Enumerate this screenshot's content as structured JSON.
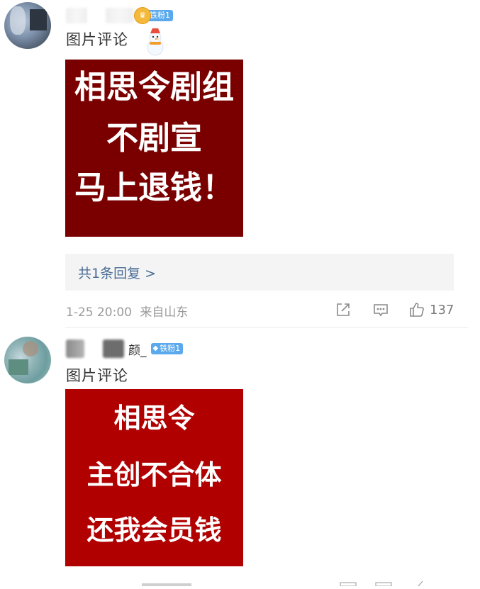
{
  "comments": [
    {
      "badge": "铁粉1",
      "type_label": "图片评论",
      "poster_lines": [
        "相思令剧组",
        "不剧宣",
        "马上退钱！"
      ],
      "poster_color": "#7a0000",
      "replies_link": "共1条回复 >",
      "timestamp": "1-25 20:00",
      "location": "来自山东",
      "likes": "137"
    },
    {
      "name_tail": "颜_",
      "badge": "铁粉1",
      "type_label": "图片评论",
      "poster_lines": [
        "相思令",
        "主创不合体",
        "还我会员钱"
      ],
      "poster_color": "#b00000"
    }
  ],
  "icons": {
    "share": "share-icon",
    "comment": "comment-icon",
    "like": "thumbs-up-icon"
  },
  "colors": {
    "link": "#4a6d96",
    "badge": "#5aa9ec"
  }
}
